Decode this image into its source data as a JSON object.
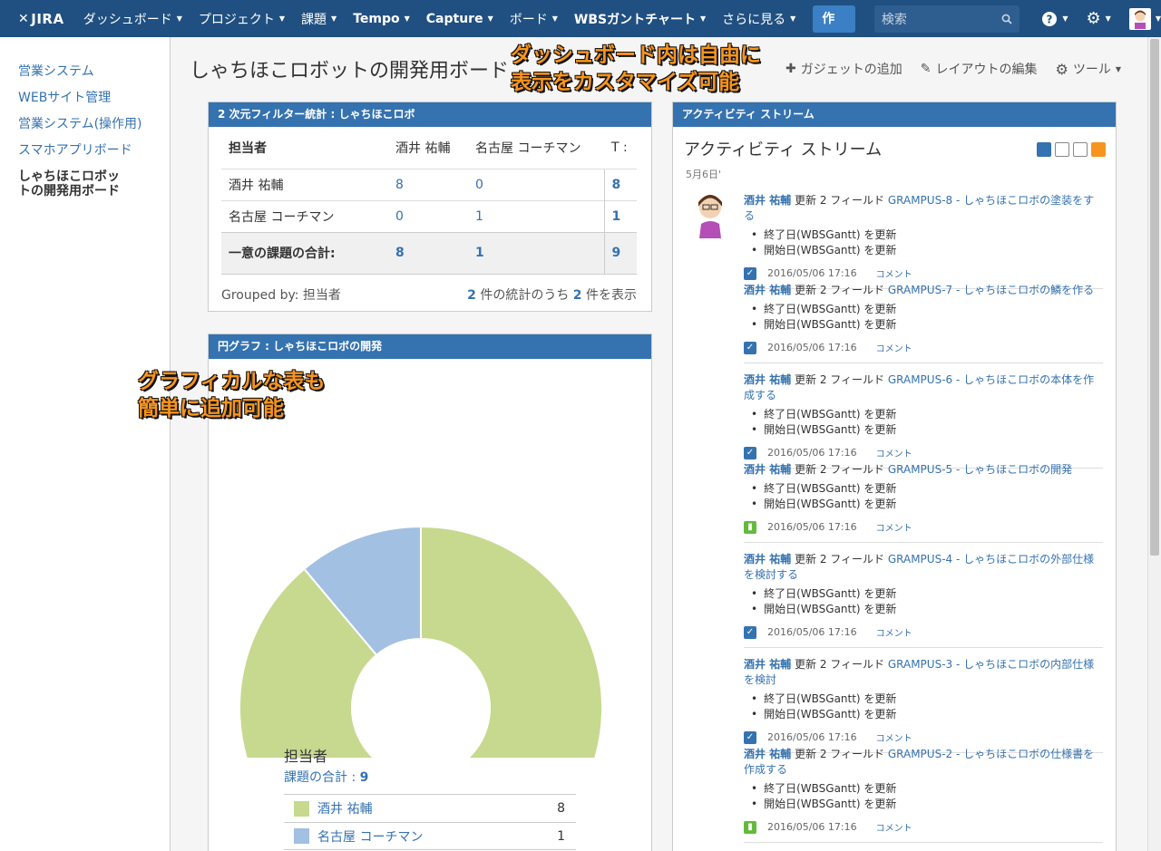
{
  "app": {
    "logo": "JIRA"
  },
  "nav": {
    "items": [
      {
        "label": "ダッシュボード"
      },
      {
        "label": "プロジェクト"
      },
      {
        "label": "課題"
      },
      {
        "label": "Tempo"
      },
      {
        "label": "Capture"
      },
      {
        "label": "ボード"
      },
      {
        "label": "WBSガントチャート"
      },
      {
        "label": "さらに見る"
      }
    ],
    "create_label": "作成",
    "search_placeholder": "検索"
  },
  "sidebar": {
    "items": [
      {
        "label": "営業システム"
      },
      {
        "label": "WEBサイト管理"
      },
      {
        "label": "営業システム(操作用)"
      },
      {
        "label": "スマホアプリボード"
      },
      {
        "label": "しゃちほこロボットの開発用ボード"
      }
    ]
  },
  "page": {
    "title": "しゃちほこロボットの開発用ボード",
    "tools": {
      "add_gadget": "ガジェットの追加",
      "edit_layout": "レイアウトの編集",
      "tools": "ツール"
    }
  },
  "callouts": {
    "top_line1": "ダッシュボード内は自由に",
    "top_line2": "表示をカスタマイズ可能",
    "left_line1": "グラフィカルな表も",
    "left_line2": "簡単に追加可能"
  },
  "stats_gadget": {
    "header": "2 次元フィルター統計 : しゃちほこロボ",
    "columns": [
      "担当者",
      "酒井 祐輔",
      "名古屋 コーチマン",
      "T :"
    ],
    "rows": [
      {
        "name": "酒井 祐輔",
        "a": "8",
        "b": "0",
        "t": "8"
      },
      {
        "name": "名古屋 コーチマン",
        "a": "0",
        "b": "1",
        "t": "1"
      }
    ],
    "total": {
      "label": "一意の課題の合計:",
      "a": "8",
      "b": "1",
      "t": "9"
    },
    "grouped_by": "Grouped by: 担当者",
    "summary_prefix": "2",
    "summary_mid": " 件の統計のうち ",
    "summary_shown": "2",
    "summary_suffix": " 件を表示"
  },
  "pie_gadget": {
    "header": "円グラフ : しゃちほこロボの開発",
    "legend_title": "担当者",
    "total_label": "課題の合計 : ",
    "total_value": "9"
  },
  "chart_data": {
    "type": "pie",
    "donut": true,
    "categories": [
      "酒井 祐輔",
      "名古屋 コーチマン"
    ],
    "values": [
      8,
      1
    ],
    "colors": [
      "#c6d98f",
      "#a1c0e2"
    ]
  },
  "activity": {
    "header": "アクティビティ ストリーム",
    "title": "アクティビティ ストリーム",
    "date_group": "5月6日'",
    "entries": [
      {
        "user": "酒井 祐輔",
        "action": " 更新 2 フィールド ",
        "issue": "GRAMPUS-8 - しゃちほこロボの塗装をする",
        "changes": [
          "終了日(WBSGantt) を更新",
          "開始日(WBSGantt) を更新"
        ],
        "time": "2016/05/06 17:16",
        "comment": "コメント",
        "type": "task"
      },
      {
        "user": "酒井 祐輔",
        "action": " 更新 2 フィールド ",
        "issue": "GRAMPUS-7 - しゃちほこロボの鱗を作る",
        "changes": [
          "終了日(WBSGantt) を更新",
          "開始日(WBSGantt) を更新"
        ],
        "time": "2016/05/06 17:16",
        "comment": "コメント",
        "type": "task"
      },
      {
        "user": "酒井 祐輔",
        "action": " 更新 2 フィールド ",
        "issue": "GRAMPUS-6 - しゃちほこロボの本体を作成する",
        "changes": [
          "終了日(WBSGantt) を更新",
          "開始日(WBSGantt) を更新"
        ],
        "time": "2016/05/06 17:16",
        "comment": "コメント",
        "type": "task"
      },
      {
        "user": "酒井 祐輔",
        "action": " 更新 2 フィールド ",
        "issue": "GRAMPUS-5 - しゃちほこロボの開発",
        "changes": [
          "終了日(WBSGantt) を更新",
          "開始日(WBSGantt) を更新"
        ],
        "time": "2016/05/06 17:16",
        "comment": "コメント",
        "type": "story"
      },
      {
        "user": "酒井 祐輔",
        "action": " 更新 2 フィールド ",
        "issue": "GRAMPUS-4 - しゃちほこロボの外部仕様を検討する",
        "changes": [
          "終了日(WBSGantt) を更新",
          "開始日(WBSGantt) を更新"
        ],
        "time": "2016/05/06 17:16",
        "comment": "コメント",
        "type": "task"
      },
      {
        "user": "酒井 祐輔",
        "action": " 更新 2 フィールド ",
        "issue": "GRAMPUS-3 - しゃちほこロボの内部仕様を検討",
        "changes": [
          "終了日(WBSGantt) を更新",
          "開始日(WBSGantt) を更新"
        ],
        "time": "2016/05/06 17:16",
        "comment": "コメント",
        "type": "task"
      },
      {
        "user": "酒井 祐輔",
        "action": " 更新 2 フィールド ",
        "issue": "GRAMPUS-2 - しゃちほこロボの仕様書を作成する",
        "changes": [
          "終了日(WBSGantt) を更新",
          "開始日(WBSGantt) を更新"
        ],
        "time": "2016/05/06 17:16",
        "comment": "コメント",
        "type": "story"
      }
    ]
  }
}
